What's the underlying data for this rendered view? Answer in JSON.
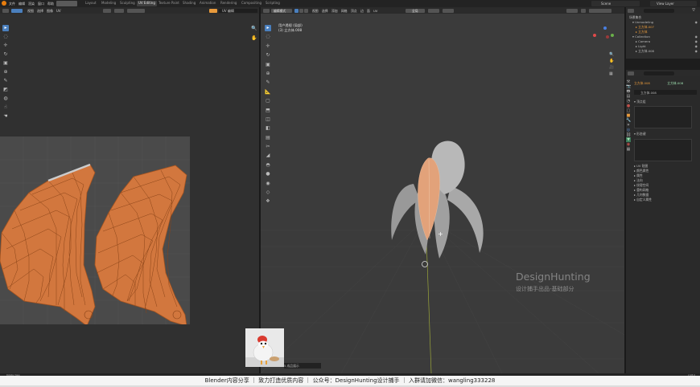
{
  "app": {
    "menus": [
      "文件",
      "编辑",
      "渲染",
      "窗口",
      "帮助"
    ],
    "workspace_tabs": [
      "Layout",
      "Modeling",
      "Sculpting",
      "UV Editing",
      "Texture Paint",
      "Shading",
      "Animation",
      "Rendering",
      "Compositing",
      "Scripting"
    ],
    "active_tab": "UV Editing",
    "scene": "Scene",
    "view_layer": "View Layer"
  },
  "uv_editor": {
    "header_items": [
      "视图",
      "选择",
      "图像",
      "UV"
    ],
    "image_name": "UV 编辑",
    "tools": [
      "cursor",
      "select",
      "move",
      "rotate",
      "scale",
      "transform",
      "annotate",
      "rip",
      "grab",
      "relax",
      "pinch"
    ]
  },
  "viewport": {
    "mode": "编辑模式",
    "header_items": [
      "视图",
      "选择",
      "添加",
      "网格",
      "顶点",
      "边",
      "面",
      "UV"
    ],
    "transform": "全局",
    "overlay_title": "用户透视 (局部)",
    "overlay_subtitle": "(3) 立方体.008",
    "watermark_title": "DesignHunting",
    "watermark_subtitle": "设计捕手出品-基础部分",
    "thumb_caption": "5.成品展示"
  },
  "outliner": {
    "title": "场景集合",
    "items": [
      {
        "label": "Unmodeling",
        "depth": 1
      },
      {
        "label": "立方体.007",
        "depth": 2
      },
      {
        "label": "立方体",
        "depth": 2
      },
      {
        "label": "Collection",
        "depth": 1
      },
      {
        "label": "Camera",
        "depth": 2
      },
      {
        "label": "Light",
        "depth": 2
      },
      {
        "label": "立方体.008",
        "depth": 2
      }
    ]
  },
  "properties": {
    "object_name": "立方体.008",
    "mesh_name": "立方体.008",
    "data_name": "立方体.008",
    "sections_top": [
      "顶点组",
      "形态键"
    ],
    "sections": [
      "UV 贴图",
      "颜色属性",
      "属性",
      "法向",
      "纹理空间",
      "重构网格",
      "几何数据",
      "自定义属性"
    ]
  },
  "status": {
    "left": "Rotate View",
    "right": "2.93.0"
  },
  "subtitle": "Blender内容分享  ｜  致力打造优质内容  ｜  公众号：DesignHunting设计捕手  ｜  入群请加微信：wangling333228",
  "colors": {
    "accent": "#4a7fbd",
    "uv_fill": "#d2773e",
    "active_tab": "#3f3f3f"
  }
}
